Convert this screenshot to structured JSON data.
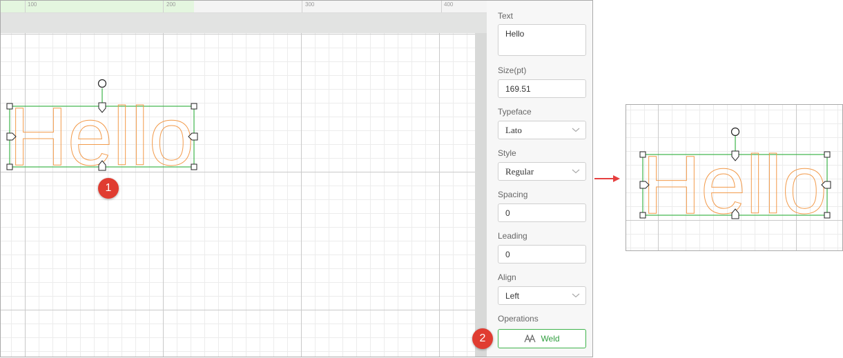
{
  "ruler": {
    "labels": [
      "100",
      "200",
      "300",
      "400"
    ]
  },
  "canvas": {
    "text": "Hello"
  },
  "panel": {
    "text_label": "Text",
    "text_value": "Hello",
    "size_label": "Size(pt)",
    "size_value": "169.51",
    "typeface_label": "Typeface",
    "typeface_value": "Lato",
    "style_label": "Style",
    "style_value": "Regular",
    "spacing_label": "Spacing",
    "spacing_value": "0",
    "leading_label": "Leading",
    "leading_value": "0",
    "align_label": "Align",
    "align_value": "Left",
    "operations_label": "Operations",
    "weld_label": "Weld"
  },
  "callouts": [
    "1",
    "2"
  ],
  "preview": {
    "text": "Hello"
  },
  "icons": [
    "rotate-handle-icon",
    "dropdown-chevron-icon",
    "weld-icon",
    "arrow-right-icon"
  ],
  "colors": {
    "accent": "#3db34a",
    "outline": "#f29a4a",
    "badge": "#e03c31",
    "arrow": "#e63f3f"
  }
}
